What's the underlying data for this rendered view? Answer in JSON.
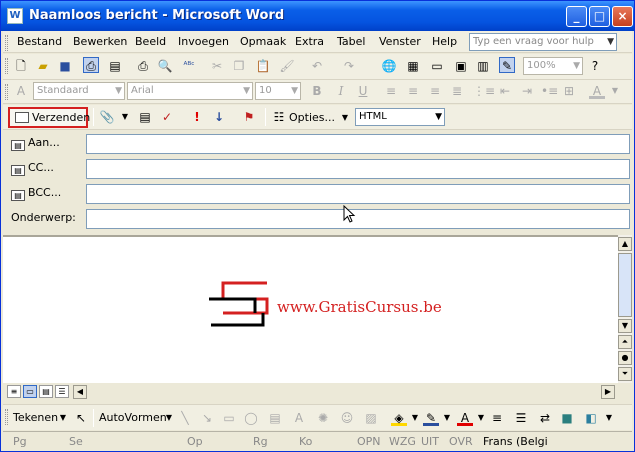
{
  "window": {
    "title": "Naamloos bericht - Microsoft Word",
    "minimize": "_",
    "maximize": "□",
    "close": "×"
  },
  "menu": {
    "items": [
      "Bestand",
      "Bewerken",
      "Beeld",
      "Invoegen",
      "Opmaak",
      "Extra",
      "Tabel",
      "Venster",
      "Help"
    ],
    "ask_placeholder": "Typ een vraag voor hulp"
  },
  "format_toolbar": {
    "style": "Standaard",
    "font": "Arial",
    "size": "10",
    "zoom": "100%"
  },
  "mail_toolbar": {
    "send": "Verzenden",
    "options": "Opties...",
    "format": "HTML"
  },
  "header_fields": {
    "to": "Aan...",
    "cc": "CC...",
    "bcc": "BCC...",
    "subject": "Onderwerp:"
  },
  "body": {
    "watermark": "www.GratisCursus.be"
  },
  "drawing_toolbar": {
    "draw": "Tekenen",
    "autoshapes": "AutoVormen"
  },
  "status": {
    "page": "Pg",
    "section": "Se",
    "at": "Op",
    "line": "Rg",
    "column": "Ko",
    "rec": "OPN",
    "trk": "WZG",
    "ext": "UIT",
    "ovr": "OVR",
    "language": "Frans (Belgi"
  },
  "colors": {
    "title_bar": "#0554e0",
    "accent_red": "#d42020",
    "highlight_yellow": "#ffd800",
    "font_red": "#e00000"
  }
}
